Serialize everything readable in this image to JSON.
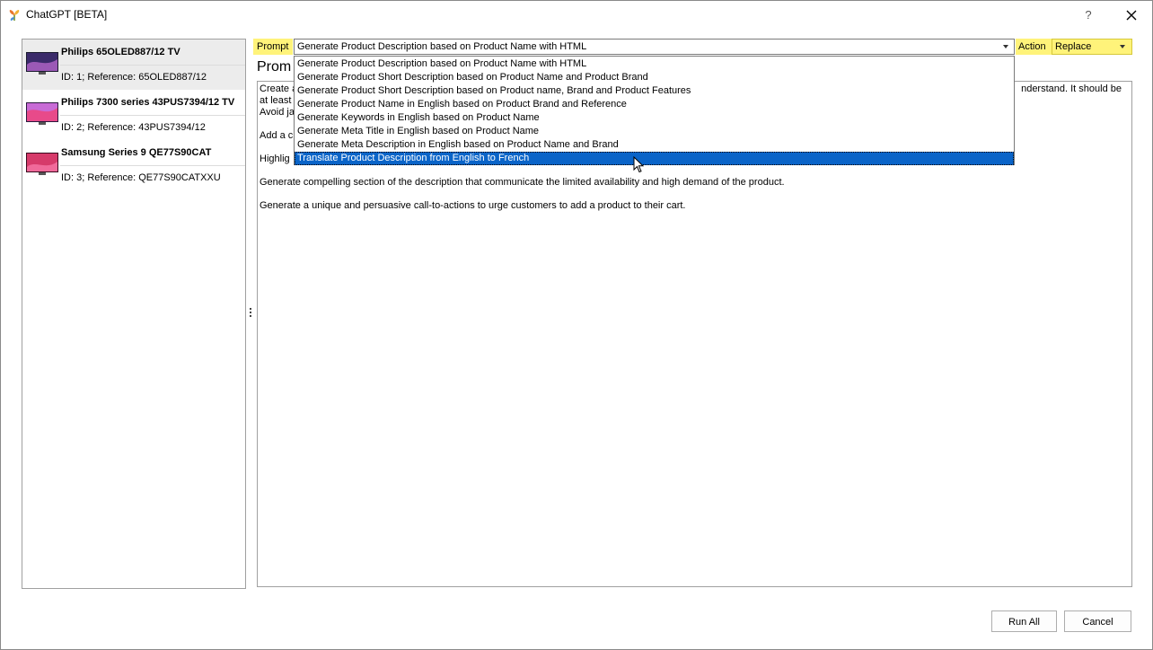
{
  "window": {
    "title": "ChatGPT [BETA]",
    "help": "?"
  },
  "products": [
    {
      "name": "Philips 65OLED887/12 TV",
      "ref": "ID: 1; Reference: 65OLED887/12",
      "selected": true
    },
    {
      "name": "Philips 7300 series 43PUS7394/12 TV",
      "ref": "ID: 2; Reference: 43PUS7394/12",
      "selected": false
    },
    {
      "name": "Samsung Series 9 QE77S90CAT",
      "ref": "ID: 3; Reference: QE77S90CATXXU",
      "selected": false
    }
  ],
  "prompt": {
    "label": "Prompt",
    "value": "Generate Product Description based on Product Name with HTML",
    "options": [
      "Generate Product Description based on Product Name with HTML",
      "Generate Product Short Description based on Product Name and Product Brand",
      "Generate Product Short Description based on Product name, Brand and Product Features",
      "Generate Product Name in English based on Product Brand and Reference",
      "Generate Keywords in English based on Product Name",
      "Generate Meta Title in English based on Product Name",
      "Generate Meta Description in English based on Product Name and Brand",
      "Translate Product Description from English to French"
    ],
    "highlighted_option": "Translate Product Description from English to French"
  },
  "action": {
    "label": "Action",
    "value": "Replace"
  },
  "prompt_heading": "Prom",
  "prompt_text": {
    "line1_left": "Create a",
    "line1_right": "nderstand. It should be",
    "line2": "at least",
    "line3": "Avoid ja",
    "line4": "Add a c",
    "line5": "Highlig",
    "line6": "Generate compelling section of the description that communicate the limited availability and high demand of the product.",
    "line7": "Generate a unique and persuasive call-to-actions to urge customers to add a product to their cart."
  },
  "buttons": {
    "run_all": "Run All",
    "cancel": "Cancel"
  },
  "colors": {
    "highlight_yellow": "#fff37a",
    "selection_blue": "#0a64c8"
  }
}
